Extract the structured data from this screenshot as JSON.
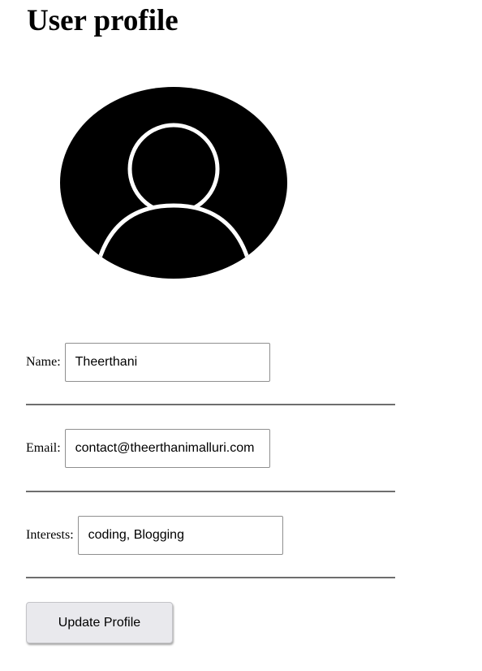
{
  "page": {
    "title": "User profile"
  },
  "avatar": {
    "icon": "user-silhouette-icon"
  },
  "form": {
    "name": {
      "label": "Name:",
      "value": "Theerthani"
    },
    "email": {
      "label": "Email:",
      "value": "contact@theerthanimalluri.com"
    },
    "interests": {
      "label": "Interests:",
      "value": "coding, Blogging"
    },
    "submit_label": "Update Profile"
  }
}
